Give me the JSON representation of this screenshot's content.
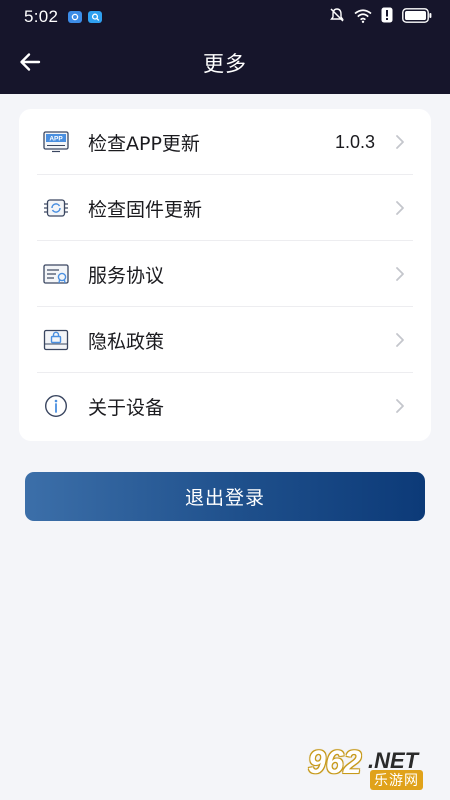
{
  "status_bar": {
    "time": "5:02",
    "icons": [
      "app-notification-icon",
      "app-notification-icon",
      "mute-icon",
      "wifi-icon",
      "alert-icon",
      "battery-icon"
    ]
  },
  "header": {
    "title": "更多",
    "back_icon": "arrow-left-icon"
  },
  "menu": {
    "items": [
      {
        "label": "检查APP更新",
        "value": "1.0.3",
        "icon": "app-update-icon"
      },
      {
        "label": "检查固件更新",
        "value": "",
        "icon": "firmware-chip-icon"
      },
      {
        "label": "服务协议",
        "value": "",
        "icon": "agreement-icon"
      },
      {
        "label": "隐私政策",
        "value": "",
        "icon": "privacy-lock-icon"
      },
      {
        "label": "关于设备",
        "value": "",
        "icon": "info-icon"
      }
    ]
  },
  "logout_label": "退出登录",
  "watermark": {
    "num": "962",
    "net": ".NET",
    "cn": "乐游网"
  },
  "colors": {
    "header_bg": "#16152b",
    "page_bg": "#f4f5f9",
    "button_gradient_start": "#3c6fa9",
    "button_gradient_end": "#0c3a78"
  }
}
